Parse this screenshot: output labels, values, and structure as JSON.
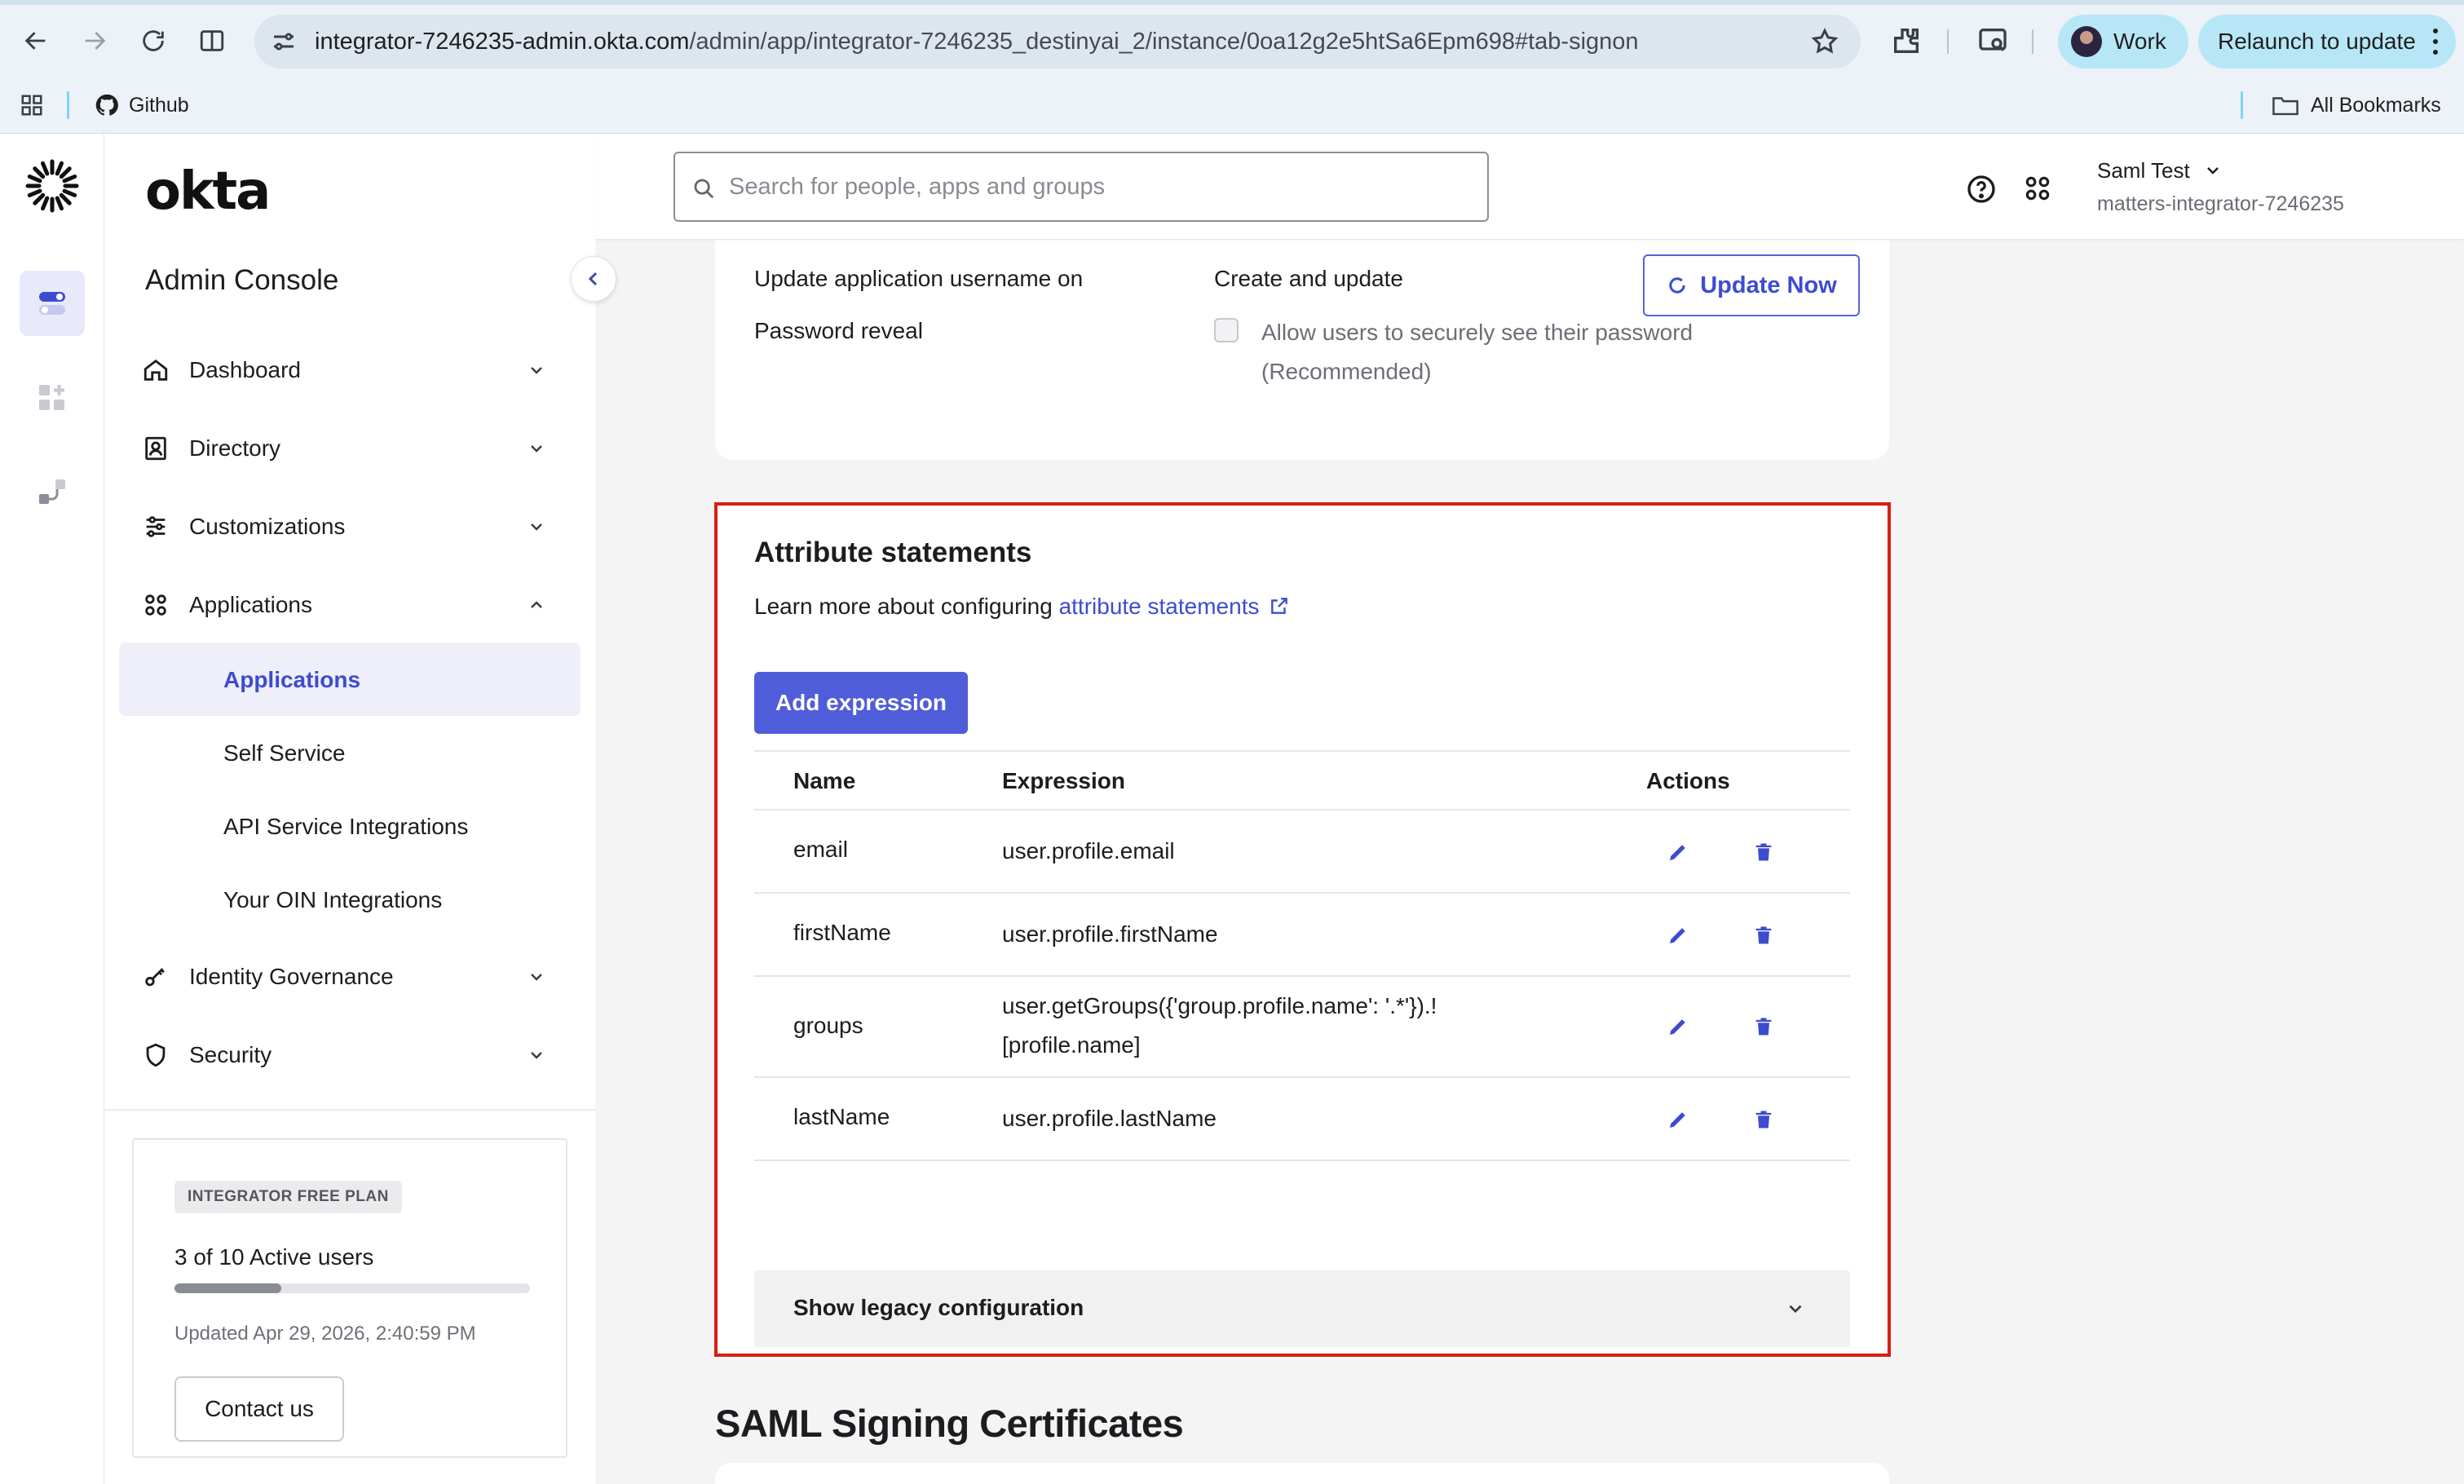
{
  "browser": {
    "url_host": "integrator-7246235-admin.okta.com",
    "url_path": "/admin/app/integrator-7246235_destinyai_2/instance/0oa12g2e5htSa6Epm698#tab-signon",
    "profile_label": "Work",
    "relaunch_label": "Relaunch to update",
    "bookmarks": [
      {
        "label": "Github",
        "icon": "github-icon"
      }
    ],
    "all_bookmarks_label": "All Bookmarks"
  },
  "sidebar": {
    "logo_text": "okta",
    "console_title": "Admin Console",
    "nav": [
      {
        "label": "Dashboard",
        "icon": "home-icon",
        "expanded": false
      },
      {
        "label": "Directory",
        "icon": "directory-icon",
        "expanded": false
      },
      {
        "label": "Customizations",
        "icon": "sliders-icon",
        "expanded": false
      },
      {
        "label": "Applications",
        "icon": "apps-grid-icon",
        "expanded": true
      },
      {
        "label": "Identity Governance",
        "icon": "key-icon",
        "expanded": false
      },
      {
        "label": "Security",
        "icon": "shield-icon",
        "expanded": false
      }
    ],
    "app_subitems": [
      {
        "label": "Applications",
        "active": true
      },
      {
        "label": "Self Service",
        "active": false
      },
      {
        "label": "API Service Integrations",
        "active": false
      },
      {
        "label": "Your OIN Integrations",
        "active": false
      }
    ],
    "plan": {
      "badge": "INTEGRATOR FREE PLAN",
      "active_users": "3 of 10 Active users",
      "active_fraction": 0.3,
      "updated": "Updated Apr 29, 2026, 2:40:59 PM",
      "contact_label": "Contact us"
    }
  },
  "header": {
    "search_placeholder": "Search for people, apps and groups",
    "user_name": "Saml Test",
    "org_name": "matters-integrator-7246235"
  },
  "settings": {
    "update_username_label": "Update application username on",
    "update_username_value": "Create and update",
    "update_now_label": "Update Now",
    "password_reveal_label": "Password reveal",
    "password_reveal_checkbox": "Allow users to securely see their password (Recommended)",
    "password_reveal_checked": false
  },
  "attributes": {
    "title": "Attribute statements",
    "learn_prefix": "Learn more about configuring",
    "learn_link": "attribute statements",
    "add_label": "Add expression",
    "columns": {
      "name": "Name",
      "expression": "Expression",
      "actions": "Actions"
    },
    "rows": [
      {
        "name": "email",
        "expression": "user.profile.email"
      },
      {
        "name": "firstName",
        "expression": "user.profile.firstName"
      },
      {
        "name": "groups",
        "expression": "user.getGroups({'group.profile.name': '.*'}).!",
        "expression_line2": "[profile.name]"
      },
      {
        "name": "lastName",
        "expression": "user.profile.lastName"
      }
    ],
    "legacy_label": "Show legacy configuration"
  },
  "next_section_title": "SAML Signing Certificates",
  "colors": {
    "accent": "#3d4ccf",
    "highlight_border": "#d61f14",
    "primary_button": "#4f5dd9"
  }
}
